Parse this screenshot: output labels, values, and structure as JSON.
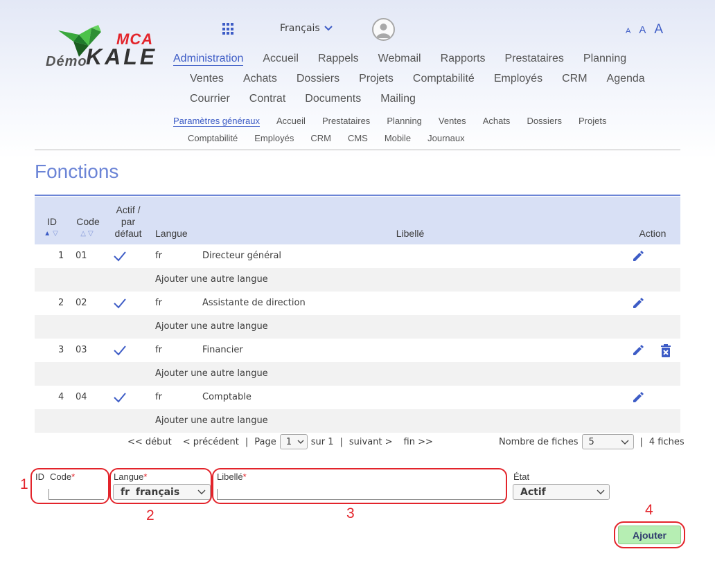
{
  "logo": {
    "demo": "Démo",
    "mca": "MCA",
    "kale": "KALE"
  },
  "header": {
    "language": "Français",
    "font_sizes": [
      "A",
      "A",
      "A"
    ]
  },
  "main_nav": {
    "row1": [
      "Administration",
      "Accueil",
      "Rappels",
      "Webmail",
      "Rapports",
      "Prestataires",
      "Planning"
    ],
    "row2": [
      "Ventes",
      "Achats",
      "Dossiers",
      "Projets",
      "Comptabilité",
      "Employés",
      "CRM",
      "Agenda"
    ],
    "row3": [
      "Courrier",
      "Contrat",
      "Documents",
      "Mailing"
    ]
  },
  "sub_nav": {
    "row1": [
      "Paramètres généraux",
      "Accueil",
      "Prestataires",
      "Planning",
      "Ventes",
      "Achats",
      "Dossiers",
      "Projets"
    ],
    "row2": [
      "Comptabilité",
      "Employés",
      "CRM",
      "CMS",
      "Mobile",
      "Journaux"
    ]
  },
  "page": {
    "title": "Fonctions"
  },
  "table": {
    "headers": {
      "id": "ID",
      "code": "Code",
      "actif_1": "Actif /",
      "actif_2": "par",
      "actif_3": "défaut",
      "langue": "Langue",
      "libelle": "Libellé",
      "action": "Action"
    },
    "rows": [
      {
        "id": "1",
        "code": "01",
        "actif": true,
        "langue": "fr",
        "libelle": "Directeur général",
        "deletable": false
      },
      {
        "id": "2",
        "code": "02",
        "actif": true,
        "langue": "fr",
        "libelle": "Assistante de direction",
        "deletable": false
      },
      {
        "id": "3",
        "code": "03",
        "actif": true,
        "langue": "fr",
        "libelle": "Financier",
        "deletable": true
      },
      {
        "id": "4",
        "code": "04",
        "actif": true,
        "langue": "fr",
        "libelle": "Comptable",
        "deletable": false
      }
    ],
    "add_language": "Ajouter une autre langue"
  },
  "pagination": {
    "first": "<< début",
    "prev": "< précédent",
    "page_label": "Page",
    "page_value": "1",
    "of": "sur 1",
    "next": "suivant >",
    "last": "fin >>",
    "records_label": "Nombre de fiches",
    "records_value": "5",
    "total": "4 fiches"
  },
  "form": {
    "id_label": "ID",
    "code_label": "Code",
    "langue_label": "Langue",
    "langue_code": "fr",
    "langue_name": "français",
    "libelle_label": "Libellé",
    "etat_label": "État",
    "etat_value": "Actif",
    "required_mark": "*",
    "submit": "Ajouter"
  },
  "annotations": [
    "1",
    "2",
    "3",
    "4"
  ],
  "colors": {
    "accent": "#3d5cc6",
    "title": "#6b84d6",
    "header_bg": "#d8e0f5",
    "annotation": "#e3242b",
    "submit_bg": "#b6eeb3"
  }
}
